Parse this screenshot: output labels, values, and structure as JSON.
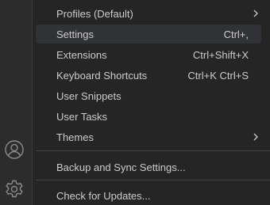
{
  "activity_bar": {
    "icons": [
      "account-icon",
      "manage-gear-icon"
    ]
  },
  "menu": {
    "items": [
      {
        "label": "Profiles (Default)",
        "keybinding": "",
        "submenu": true
      },
      {
        "label": "Settings",
        "keybinding": "Ctrl+,",
        "submenu": false
      },
      {
        "label": "Extensions",
        "keybinding": "Ctrl+Shift+X",
        "submenu": false
      },
      {
        "label": "Keyboard Shortcuts",
        "keybinding": "Ctrl+K Ctrl+S",
        "submenu": false
      },
      {
        "label": "User Snippets",
        "keybinding": "",
        "submenu": false
      },
      {
        "label": "User Tasks",
        "keybinding": "",
        "submenu": false
      },
      {
        "label": "Themes",
        "keybinding": "",
        "submenu": true
      },
      {
        "label": "Backup and Sync Settings...",
        "keybinding": "",
        "submenu": false
      },
      {
        "label": "Check for Updates...",
        "keybinding": "",
        "submenu": false
      }
    ]
  },
  "colors": {
    "background": "#252526",
    "activity_bar": "#2c2c2c",
    "highlight": "#313236",
    "separator": "#454545",
    "text": "#cccccc"
  }
}
